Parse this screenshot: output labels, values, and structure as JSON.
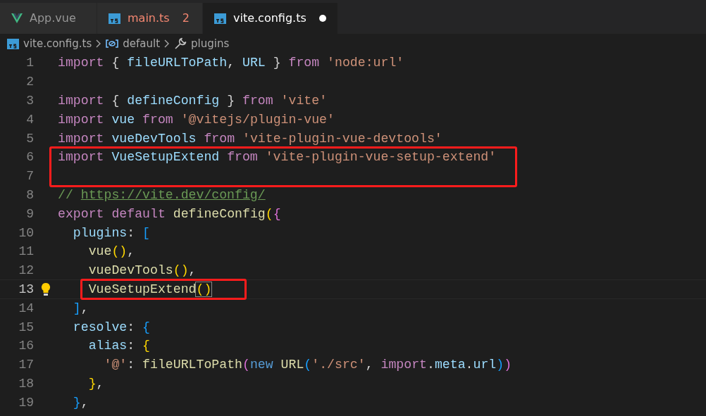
{
  "tabs": [
    {
      "label": "App.vue",
      "kind": "vue",
      "selected": false,
      "error": false,
      "modified": false
    },
    {
      "label": "main.ts",
      "kind": "ts",
      "selected": false,
      "error": true,
      "badge": "2",
      "modified": false
    },
    {
      "label": "vite.config.ts",
      "kind": "ts",
      "selected": true,
      "error": false,
      "modified": true
    }
  ],
  "breadcrumb": [
    {
      "label": "vite.config.ts",
      "kind": "ts"
    },
    {
      "label": "default",
      "kind": "variable"
    },
    {
      "label": "plugins",
      "kind": "wrench"
    }
  ],
  "lines": [
    {
      "number": "1",
      "tokens": [
        {
          "text": "import ",
          "kind": "kw"
        },
        {
          "text": "{ ",
          "kind": "punc"
        },
        {
          "text": "fileURLToPath",
          "kind": "var"
        },
        {
          "text": ", ",
          "kind": "punc"
        },
        {
          "text": "URL",
          "kind": "var"
        },
        {
          "text": " } ",
          "kind": "punc"
        },
        {
          "text": "from ",
          "kind": "kw"
        },
        {
          "text": "'node:url'",
          "kind": "str"
        }
      ]
    },
    {
      "number": "2"
    },
    {
      "number": "3",
      "tokens": [
        {
          "text": "import ",
          "kind": "kw"
        },
        {
          "text": "{ ",
          "kind": "punc"
        },
        {
          "text": "defineConfig",
          "kind": "var"
        },
        {
          "text": " } ",
          "kind": "punc"
        },
        {
          "text": "from ",
          "kind": "kw"
        },
        {
          "text": "'vite'",
          "kind": "str"
        }
      ]
    },
    {
      "number": "4",
      "tokens": [
        {
          "text": "import ",
          "kind": "kw"
        },
        {
          "text": "vue ",
          "kind": "var"
        },
        {
          "text": "from ",
          "kind": "kw"
        },
        {
          "text": "'@vitejs/plugin-vue'",
          "kind": "str"
        }
      ]
    },
    {
      "number": "5",
      "tokens": [
        {
          "text": "import ",
          "kind": "kw"
        },
        {
          "text": "vueDevTools ",
          "kind": "var"
        },
        {
          "text": "from ",
          "kind": "kw"
        },
        {
          "text": "'vite-plugin-vue-devtools'",
          "kind": "str"
        }
      ]
    },
    {
      "number": "6",
      "highlighted": true,
      "tokens": [
        {
          "text": "import ",
          "kind": "kw"
        },
        {
          "text": "VueSetupExtend ",
          "kind": "var"
        },
        {
          "text": "from ",
          "kind": "kw"
        },
        {
          "text": "'vite-plugin-vue-setup-extend'",
          "kind": "str"
        }
      ]
    },
    {
      "number": "7",
      "highlighted": true
    },
    {
      "number": "8",
      "tokens": [
        {
          "text": "// ",
          "kind": "comment"
        },
        {
          "text": "https://vite.dev/config/",
          "kind": "link"
        }
      ]
    },
    {
      "number": "9",
      "tokens": [
        {
          "text": "export ",
          "kind": "kw"
        },
        {
          "text": "default ",
          "kind": "kw"
        },
        {
          "text": "defineConfig",
          "kind": "fn"
        },
        {
          "text": "(",
          "kind": "brace1"
        },
        {
          "text": "{",
          "kind": "brace2"
        }
      ]
    },
    {
      "number": "10",
      "tokens": [
        {
          "text": "  plugins",
          "kind": "var"
        },
        {
          "text": ": ",
          "kind": "punc"
        },
        {
          "text": "[",
          "kind": "brace3"
        }
      ]
    },
    {
      "number": "11",
      "tokens": [
        {
          "text": "    vue",
          "kind": "fn"
        },
        {
          "text": "()",
          "kind": "brace1"
        },
        {
          "text": ",",
          "kind": "punc"
        }
      ]
    },
    {
      "number": "12",
      "tokens": [
        {
          "text": "    vueDevTools",
          "kind": "fn"
        },
        {
          "text": "()",
          "kind": "brace1"
        },
        {
          "text": ",",
          "kind": "punc"
        }
      ]
    },
    {
      "number": "13",
      "highlighted": true,
      "current": true,
      "lightbulb": true,
      "tokens": [
        {
          "text": "    VueSetupExtend",
          "kind": "fn"
        },
        {
          "text": "()",
          "kind": "match"
        }
      ]
    },
    {
      "number": "14",
      "tokens": [
        {
          "text": "  ]",
          "kind": "brace3"
        },
        {
          "text": ",",
          "kind": "punc"
        }
      ]
    },
    {
      "number": "15",
      "tokens": [
        {
          "text": "  resolve",
          "kind": "var"
        },
        {
          "text": ": ",
          "kind": "punc"
        },
        {
          "text": "{",
          "kind": "brace3"
        }
      ]
    },
    {
      "number": "16",
      "tokens": [
        {
          "text": "    alias",
          "kind": "var"
        },
        {
          "text": ": ",
          "kind": "punc"
        },
        {
          "text": "{",
          "kind": "brace1"
        }
      ]
    },
    {
      "number": "17",
      "tokens": [
        {
          "text": "      '@'",
          "kind": "str"
        },
        {
          "text": ": ",
          "kind": "punc"
        },
        {
          "text": "fileURLToPath",
          "kind": "fn"
        },
        {
          "text": "(",
          "kind": "brace2"
        },
        {
          "text": "new ",
          "kind": "new"
        },
        {
          "text": "URL",
          "kind": "fn"
        },
        {
          "text": "(",
          "kind": "brace3"
        },
        {
          "text": "'./src'",
          "kind": "str"
        },
        {
          "text": ", ",
          "kind": "punc"
        },
        {
          "text": "import",
          "kind": "kw"
        },
        {
          "text": ".",
          "kind": "punc"
        },
        {
          "text": "meta",
          "kind": "var"
        },
        {
          "text": ".",
          "kind": "punc"
        },
        {
          "text": "url",
          "kind": "var"
        },
        {
          "text": ")",
          "kind": "brace3"
        },
        {
          "text": ")",
          "kind": "brace2"
        }
      ]
    },
    {
      "number": "18",
      "tokens": [
        {
          "text": "    }",
          "kind": "brace1"
        },
        {
          "text": ",",
          "kind": "punc"
        }
      ]
    },
    {
      "number": "19",
      "tokens": [
        {
          "text": "  }",
          "kind": "brace3"
        },
        {
          "text": ",",
          "kind": "punc"
        }
      ]
    }
  ]
}
